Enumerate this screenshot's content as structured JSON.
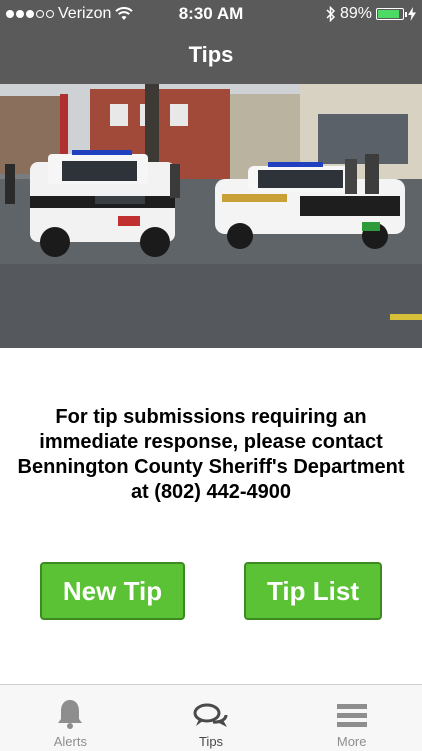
{
  "status": {
    "carrier": "Verizon",
    "time": "8:30 AM",
    "battery": "89%",
    "battery_level": 0.89,
    "signal_bars": 3
  },
  "nav": {
    "title": "Tips"
  },
  "hero": {
    "icon": "photo-of-sheriff-vehicles"
  },
  "message": {
    "text": "For tip submissions requiring an immediate response, please contact Bennington County Sheriff's Department at (802) 442-4900"
  },
  "buttons": {
    "new_tip": "New Tip",
    "tip_list": "Tip List"
  },
  "colors": {
    "bar": "#5a5a5a",
    "button": "#5bc236",
    "battery": "#4cd964"
  },
  "tabs": [
    {
      "label": "Alerts",
      "icon": "bell-icon"
    },
    {
      "label": "Tips",
      "icon": "chat-bubbles-icon",
      "active": true
    },
    {
      "label": "More",
      "icon": "menu-icon"
    }
  ]
}
